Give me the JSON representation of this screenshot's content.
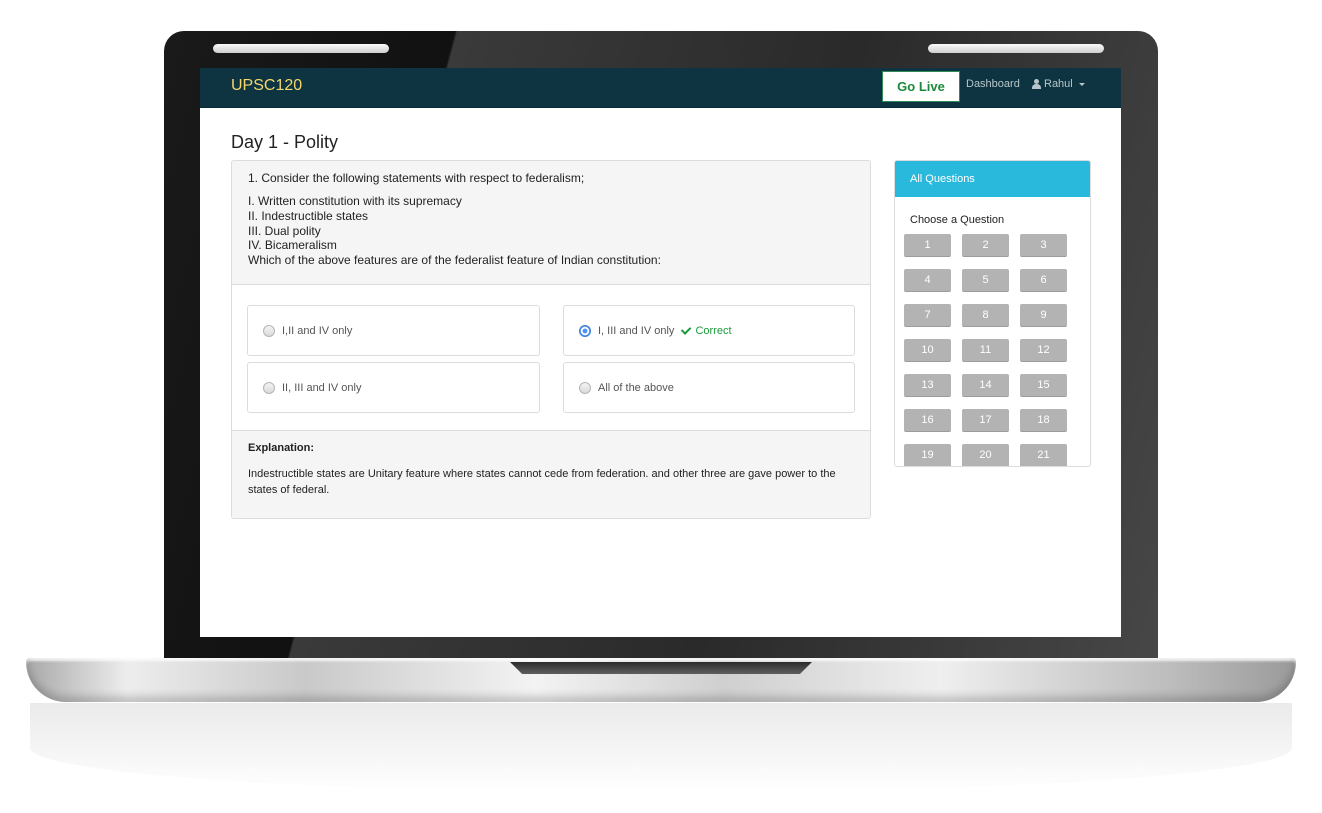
{
  "navbar": {
    "brand": "UPSC120",
    "go_live": "Go Live",
    "dashboard": "Dashboard",
    "user": "Rahul"
  },
  "page": {
    "title": "Day 1 - Polity"
  },
  "question": {
    "text": "1. Consider the following statements with respect to federalism;",
    "statements": [
      "I. Written constitution with its supremacy",
      "II. Indestructible states",
      "III. Dual polity",
      "IV. Bicameralism",
      "Which of the above features are of the federalist feature of Indian constitution:"
    ],
    "options": [
      {
        "label": "I,II and IV only",
        "selected": false
      },
      {
        "label": "I, III and IV only",
        "selected": true,
        "feedback": "Correct"
      },
      {
        "label": "II, III and IV only",
        "selected": false
      },
      {
        "label": "All of the above",
        "selected": false
      }
    ]
  },
  "explanation": {
    "title": "Explanation:",
    "text": "Indestructible states are Unitary feature where states cannot cede from federation. and other three are gave power to the states of federal."
  },
  "sidebar": {
    "header": "All Questions",
    "subtitle": "Choose a Question",
    "questions": [
      "1",
      "2",
      "3",
      "4",
      "5",
      "6",
      "7",
      "8",
      "9",
      "10",
      "11",
      "12",
      "13",
      "14",
      "15",
      "16",
      "17",
      "18",
      "19",
      "20",
      "21"
    ]
  },
  "colors": {
    "navbar": "#0d3440",
    "brand": "#f5d76e",
    "accent": "#29b9dc",
    "correct": "#1a9a3a",
    "question_button": "#b3b3b3"
  }
}
